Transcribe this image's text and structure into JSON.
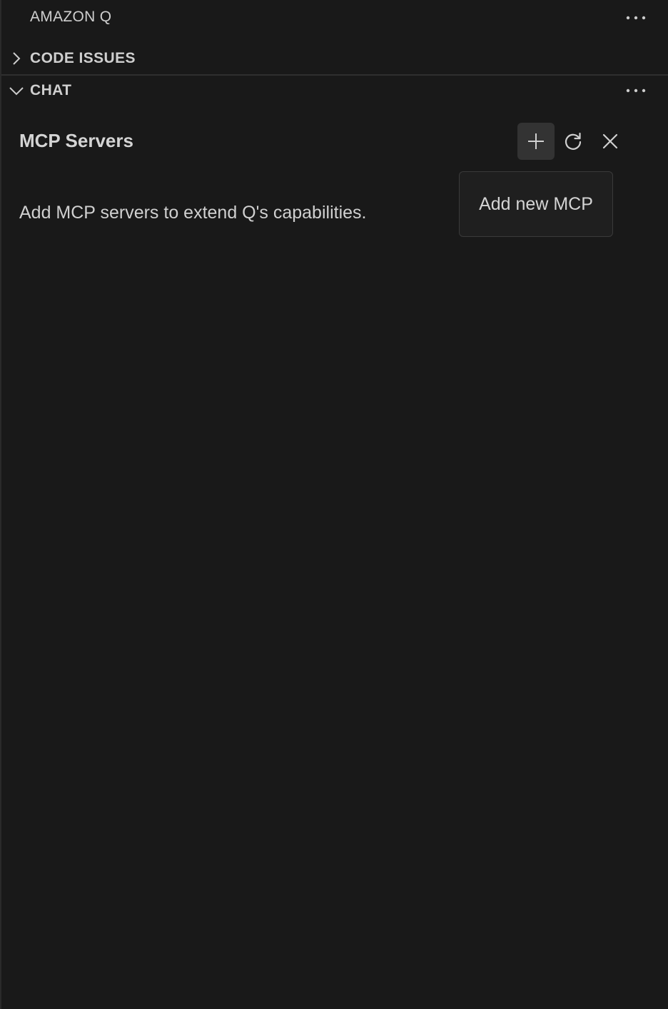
{
  "view": {
    "title": "AMAZON Q"
  },
  "sections": {
    "code_issues": {
      "label": "CODE ISSUES",
      "expanded": false
    },
    "chat": {
      "label": "CHAT",
      "expanded": true
    }
  },
  "mcp": {
    "title": "MCP Servers",
    "description": "Add MCP servers to extend Q's capabilities.",
    "tooltip": "Add new MCP",
    "actions": {
      "add": "plus-icon",
      "refresh": "refresh-icon",
      "close": "close-icon"
    }
  },
  "colors": {
    "background": "#191919",
    "text": "#cccccc",
    "button_active": "#333333"
  }
}
